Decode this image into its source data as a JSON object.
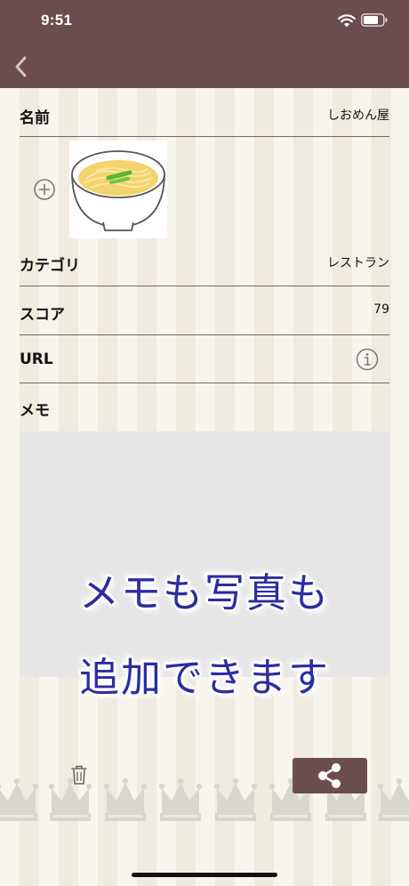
{
  "status_bar": {
    "time": "9:51",
    "icons": [
      "wifi-icon",
      "battery-icon"
    ]
  },
  "nav": {
    "back_icon": "chevron-left-icon"
  },
  "form": {
    "name": {
      "label": "名前",
      "value": "しおめん屋"
    },
    "photo": {
      "add_icon": "plus-circle-icon",
      "image": "ramen-bowl-photo"
    },
    "category": {
      "label": "カテゴリ",
      "value": "レストラン"
    },
    "score": {
      "label": "スコア",
      "value": "79"
    },
    "url": {
      "label": "URL",
      "value": "",
      "info_icon": "info-icon"
    },
    "memo": {
      "label": "メモ",
      "value": ""
    }
  },
  "promo": {
    "line1": "メモも写真も",
    "line2": "追加できます"
  },
  "toolbar": {
    "trash_icon": "trash-icon",
    "share_icon": "share-icon"
  },
  "colors": {
    "header": "#6c4d4f",
    "share_button": "#6c4d4f",
    "promo_text": "#2b2da0",
    "memo_background": "#e6e6e6",
    "stripe_light": "#f8f5ee",
    "stripe_dark": "#efebe1",
    "divider": "#7a6664",
    "crown": "#d9d6cd"
  }
}
